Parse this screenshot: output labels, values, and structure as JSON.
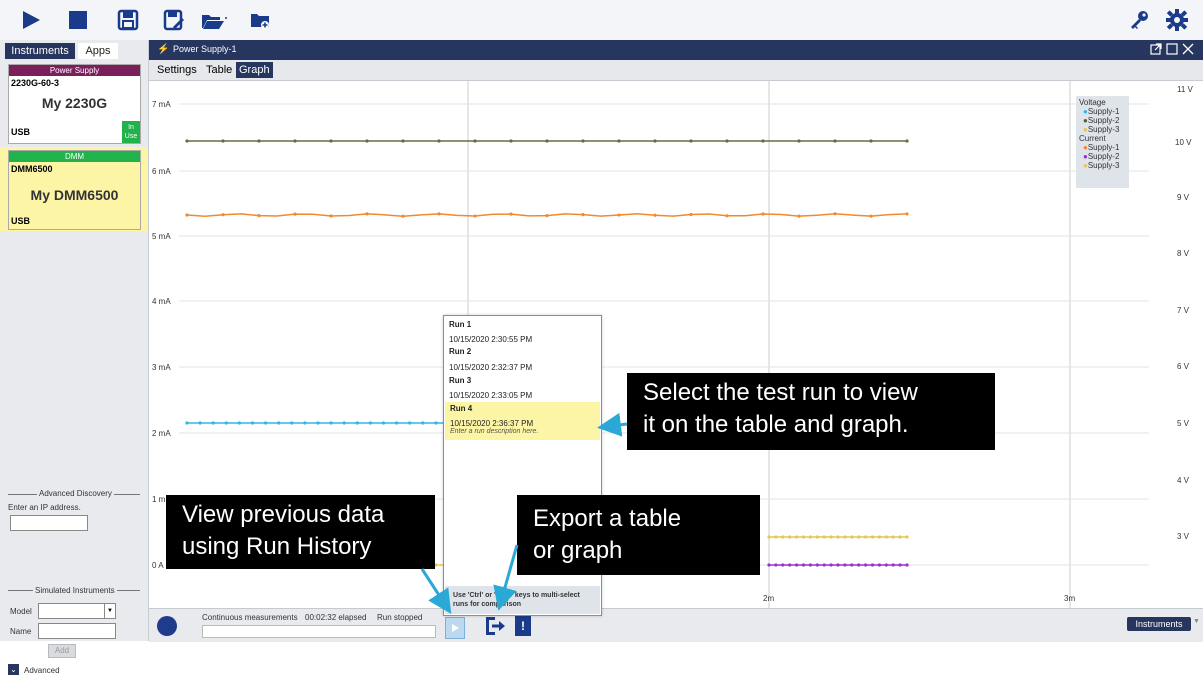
{
  "toolbar": {
    "icons": [
      "play-icon",
      "stop-icon",
      "save-icon",
      "save-as-icon",
      "open-icon",
      "new-folder-icon",
      "key-icon",
      "settings-icon"
    ]
  },
  "left_panel": {
    "tabs": [
      "Instruments",
      "Apps"
    ],
    "cards": [
      {
        "header": "Power Supply",
        "model": "2230G-60-3",
        "name": "My 2230G",
        "conn": "USB",
        "badge": "In\nUse",
        "header_color": "#7a1f5c"
      },
      {
        "header": "DMM",
        "model": "DMM6500",
        "name": "My DMM6500",
        "conn": "USB",
        "header_color": "#21b24b"
      }
    ],
    "adv_discovery": "Advanced Discovery",
    "ip_label": "Enter an IP address.",
    "sim_title": "Simulated Instruments",
    "model_label": "Model",
    "name_label": "Name",
    "add_label": "Add",
    "advanced_label": "Advanced"
  },
  "main": {
    "header_title": "Power Supply-1",
    "subtabs": [
      "Settings",
      "Table",
      "Graph"
    ],
    "y_left": [
      "7 mA",
      "6 mA",
      "5 mA",
      "4 mA",
      "3 mA",
      "2 mA",
      "1 m",
      "0 A"
    ],
    "y_right": [
      "11 V",
      "10 V",
      "9 V",
      "8 V",
      "7 V",
      "6 V",
      "5 V",
      "4 V",
      "3 V"
    ],
    "x_labels": [
      "2m",
      "3m"
    ],
    "legend": {
      "voltage_title": "Voltage",
      "voltage": [
        {
          "name": "Supply-1",
          "color": "#2eb8e6"
        },
        {
          "name": "Supply-2",
          "color": "#5a5a3a"
        },
        {
          "name": "Supply-3",
          "color": "#e6c650"
        }
      ],
      "current_title": "Current",
      "current": [
        {
          "name": "Supply-1",
          "color": "#f08a2c"
        },
        {
          "name": "Supply-2",
          "color": "#9a30d0"
        },
        {
          "name": "Supply-3",
          "color": "#e6c650"
        }
      ]
    }
  },
  "runs": {
    "items": [
      {
        "title": "Run 1",
        "date": "10/15/2020 2:30:55 PM"
      },
      {
        "title": "Run 2",
        "date": "10/15/2020 2:32:37 PM"
      },
      {
        "title": "Run 3",
        "date": "10/15/2020 2:33:05 PM"
      },
      {
        "title": "Run 4",
        "date": "10/15/2020 2:36:37 PM",
        "desc": "Enter a run description here."
      }
    ],
    "hint": "Use 'Ctrl' or 'Shift' keys to multi-select runs for comparison"
  },
  "status": {
    "continuous": "Continuous measurements",
    "elapsed": "00:02:32 elapsed",
    "state": "Run stopped",
    "instruments_button": "Instruments"
  },
  "callouts": {
    "select": "Select the test run to view it on the table and graph.",
    "select_l1": "Select the test run to view",
    "select_l2": "it on the table and graph.",
    "history_l1": "View previous data",
    "history_l2": "using Run History",
    "export_l1": "Export a table",
    "export_l2": "or graph"
  },
  "colors": {
    "accent": "#26365e",
    "run_selected": "#fdf5a6",
    "callout_arrow": "#2aa8d6"
  }
}
